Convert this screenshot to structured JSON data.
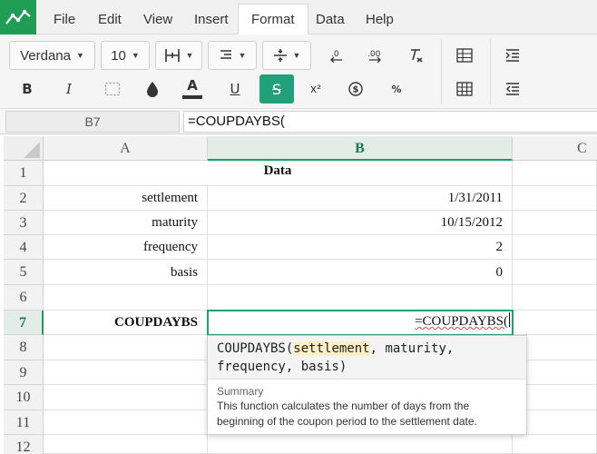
{
  "menu": {
    "items": [
      "File",
      "Edit",
      "View",
      "Insert",
      "Format",
      "Data",
      "Help"
    ],
    "active": "Format"
  },
  "toolbar": {
    "font_family": "Verdana",
    "font_size": "10",
    "bold_label": "B",
    "italic_label": "I",
    "underline_label": "U",
    "strikethrough_label": "S",
    "superscript_label": "x²",
    "percent_label": "%",
    "accent_color": "#21a179"
  },
  "formula_bar": {
    "cell_ref": "B7",
    "formula": "=COUPDAYBS("
  },
  "grid": {
    "columns": [
      "A",
      "B",
      "C"
    ],
    "selected_column": "B",
    "rows": [
      "1",
      "2",
      "3",
      "4",
      "5",
      "6",
      "7",
      "8",
      "9",
      "10",
      "11",
      "12"
    ],
    "selected_row": "7",
    "cells": {
      "b1": "Data",
      "a2": "settlement",
      "b2": "1/31/2011",
      "a3": "maturity",
      "b3": "10/15/2012",
      "a4": "frequency",
      "b4": "2",
      "a5": "basis",
      "b5": "0",
      "a7": "COUPDAYBS",
      "b7": "=COUPDAYBS("
    }
  },
  "autocomplete": {
    "fn": "COUPDAYBS(",
    "arg_current": "settlement",
    "args_rest_line1": ", maturity,",
    "args_line2": "frequency, basis)",
    "summary_title": "Summary",
    "summary_text": "This function calculates the number of days from the beginning of the coupon period to the settlement date."
  }
}
